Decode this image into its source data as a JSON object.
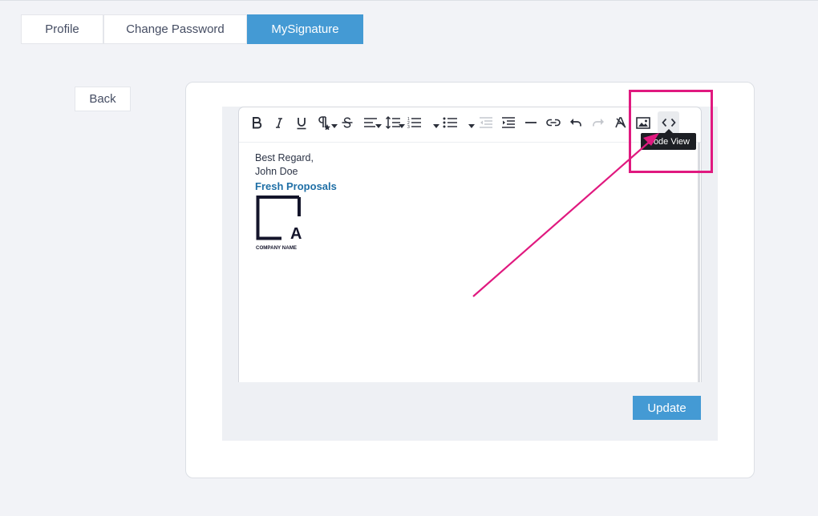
{
  "tabs": [
    {
      "label": "Profile",
      "active": false
    },
    {
      "label": "Change Password",
      "active": false
    },
    {
      "label": "MySignature",
      "active": true
    }
  ],
  "back_label": "Back",
  "editor": {
    "toolbar": [
      "bold-icon",
      "italic-icon",
      "underline-icon",
      "paragraph-style-icon",
      "strikethrough-icon",
      "align-icon",
      "line-height-icon",
      "ordered-list-icon",
      "unordered-list-icon",
      "outdent-icon",
      "indent-icon",
      "horizontal-rule-icon",
      "link-icon",
      "undo-icon",
      "redo-icon",
      "remove-format-icon",
      "image-icon",
      "code-view-icon"
    ],
    "tooltip": "Code View",
    "content": {
      "line1": "Best Regard,",
      "line2": "John Doe",
      "brand": "Fresh Proposals",
      "logo_letter": "A",
      "logo_caption": "COMPANY NAME"
    }
  },
  "update_label": "Update",
  "colors": {
    "accent": "#449ad4",
    "annotation": "#e0197f",
    "brand_text": "#1f6fa6"
  }
}
